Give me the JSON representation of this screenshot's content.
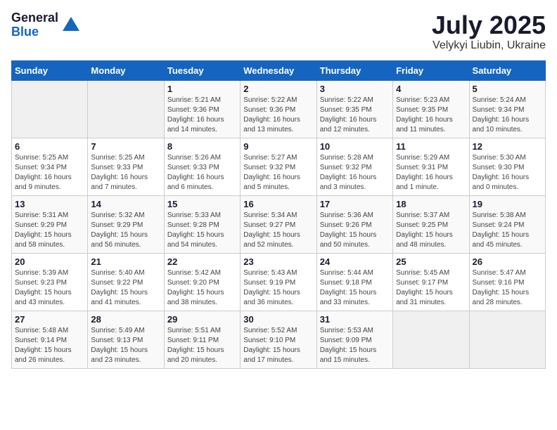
{
  "header": {
    "logo_general": "General",
    "logo_blue": "Blue",
    "month_title": "July 2025",
    "location": "Velykyi Liubin, Ukraine"
  },
  "weekdays": [
    "Sunday",
    "Monday",
    "Tuesday",
    "Wednesday",
    "Thursday",
    "Friday",
    "Saturday"
  ],
  "weeks": [
    [
      {
        "day": "",
        "info": ""
      },
      {
        "day": "",
        "info": ""
      },
      {
        "day": "1",
        "info": "Sunrise: 5:21 AM\nSunset: 9:36 PM\nDaylight: 16 hours and 14 minutes."
      },
      {
        "day": "2",
        "info": "Sunrise: 5:22 AM\nSunset: 9:36 PM\nDaylight: 16 hours and 13 minutes."
      },
      {
        "day": "3",
        "info": "Sunrise: 5:22 AM\nSunset: 9:35 PM\nDaylight: 16 hours and 12 minutes."
      },
      {
        "day": "4",
        "info": "Sunrise: 5:23 AM\nSunset: 9:35 PM\nDaylight: 16 hours and 11 minutes."
      },
      {
        "day": "5",
        "info": "Sunrise: 5:24 AM\nSunset: 9:34 PM\nDaylight: 16 hours and 10 minutes."
      }
    ],
    [
      {
        "day": "6",
        "info": "Sunrise: 5:25 AM\nSunset: 9:34 PM\nDaylight: 16 hours and 9 minutes."
      },
      {
        "day": "7",
        "info": "Sunrise: 5:25 AM\nSunset: 9:33 PM\nDaylight: 16 hours and 7 minutes."
      },
      {
        "day": "8",
        "info": "Sunrise: 5:26 AM\nSunset: 9:33 PM\nDaylight: 16 hours and 6 minutes."
      },
      {
        "day": "9",
        "info": "Sunrise: 5:27 AM\nSunset: 9:32 PM\nDaylight: 16 hours and 5 minutes."
      },
      {
        "day": "10",
        "info": "Sunrise: 5:28 AM\nSunset: 9:32 PM\nDaylight: 16 hours and 3 minutes."
      },
      {
        "day": "11",
        "info": "Sunrise: 5:29 AM\nSunset: 9:31 PM\nDaylight: 16 hours and 1 minute."
      },
      {
        "day": "12",
        "info": "Sunrise: 5:30 AM\nSunset: 9:30 PM\nDaylight: 16 hours and 0 minutes."
      }
    ],
    [
      {
        "day": "13",
        "info": "Sunrise: 5:31 AM\nSunset: 9:29 PM\nDaylight: 15 hours and 58 minutes."
      },
      {
        "day": "14",
        "info": "Sunrise: 5:32 AM\nSunset: 9:29 PM\nDaylight: 15 hours and 56 minutes."
      },
      {
        "day": "15",
        "info": "Sunrise: 5:33 AM\nSunset: 9:28 PM\nDaylight: 15 hours and 54 minutes."
      },
      {
        "day": "16",
        "info": "Sunrise: 5:34 AM\nSunset: 9:27 PM\nDaylight: 15 hours and 52 minutes."
      },
      {
        "day": "17",
        "info": "Sunrise: 5:36 AM\nSunset: 9:26 PM\nDaylight: 15 hours and 50 minutes."
      },
      {
        "day": "18",
        "info": "Sunrise: 5:37 AM\nSunset: 9:25 PM\nDaylight: 15 hours and 48 minutes."
      },
      {
        "day": "19",
        "info": "Sunrise: 5:38 AM\nSunset: 9:24 PM\nDaylight: 15 hours and 45 minutes."
      }
    ],
    [
      {
        "day": "20",
        "info": "Sunrise: 5:39 AM\nSunset: 9:23 PM\nDaylight: 15 hours and 43 minutes."
      },
      {
        "day": "21",
        "info": "Sunrise: 5:40 AM\nSunset: 9:22 PM\nDaylight: 15 hours and 41 minutes."
      },
      {
        "day": "22",
        "info": "Sunrise: 5:42 AM\nSunset: 9:20 PM\nDaylight: 15 hours and 38 minutes."
      },
      {
        "day": "23",
        "info": "Sunrise: 5:43 AM\nSunset: 9:19 PM\nDaylight: 15 hours and 36 minutes."
      },
      {
        "day": "24",
        "info": "Sunrise: 5:44 AM\nSunset: 9:18 PM\nDaylight: 15 hours and 33 minutes."
      },
      {
        "day": "25",
        "info": "Sunrise: 5:45 AM\nSunset: 9:17 PM\nDaylight: 15 hours and 31 minutes."
      },
      {
        "day": "26",
        "info": "Sunrise: 5:47 AM\nSunset: 9:16 PM\nDaylight: 15 hours and 28 minutes."
      }
    ],
    [
      {
        "day": "27",
        "info": "Sunrise: 5:48 AM\nSunset: 9:14 PM\nDaylight: 15 hours and 26 minutes."
      },
      {
        "day": "28",
        "info": "Sunrise: 5:49 AM\nSunset: 9:13 PM\nDaylight: 15 hours and 23 minutes."
      },
      {
        "day": "29",
        "info": "Sunrise: 5:51 AM\nSunset: 9:11 PM\nDaylight: 15 hours and 20 minutes."
      },
      {
        "day": "30",
        "info": "Sunrise: 5:52 AM\nSunset: 9:10 PM\nDaylight: 15 hours and 17 minutes."
      },
      {
        "day": "31",
        "info": "Sunrise: 5:53 AM\nSunset: 9:09 PM\nDaylight: 15 hours and 15 minutes."
      },
      {
        "day": "",
        "info": ""
      },
      {
        "day": "",
        "info": ""
      }
    ]
  ]
}
